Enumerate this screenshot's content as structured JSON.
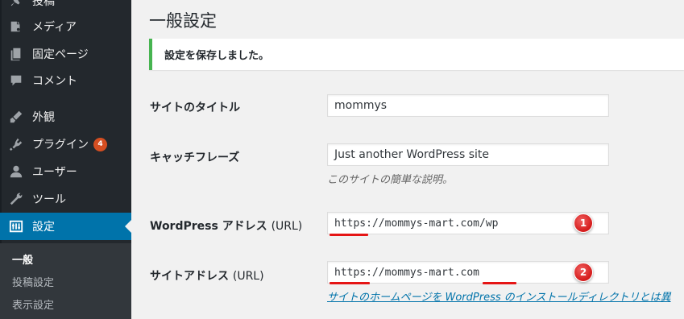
{
  "sidebar": {
    "items": [
      {
        "label": "投稿",
        "icon": "pin-icon"
      },
      {
        "label": "メディア",
        "icon": "media-icon"
      },
      {
        "label": "固定ページ",
        "icon": "page-icon"
      },
      {
        "label": "コメント",
        "icon": "comment-icon"
      },
      {
        "label": "外観",
        "icon": "brush-icon"
      },
      {
        "label": "プラグイン",
        "icon": "plugin-icon",
        "badge": "4"
      },
      {
        "label": "ユーザー",
        "icon": "user-icon"
      },
      {
        "label": "ツール",
        "icon": "wrench-icon"
      },
      {
        "label": "設定",
        "icon": "settings-icon",
        "active": true
      }
    ],
    "submenu": [
      {
        "label": "一般",
        "current": true
      },
      {
        "label": "投稿設定"
      },
      {
        "label": "表示設定"
      }
    ]
  },
  "main": {
    "title": "一般設定",
    "notice": "設定を保存しました。",
    "fields": {
      "site_title": {
        "label": "サイトのタイトル",
        "value": "mommys"
      },
      "tagline": {
        "label": "キャッチフレーズ",
        "value": "Just another WordPress site",
        "description": "このサイトの簡単な説明。"
      },
      "wp_address": {
        "label_main": "WordPress アドレス",
        "label_suffix": "(URL)",
        "value": "https://mommys-mart.com/wp"
      },
      "site_address": {
        "label_main": "サイトアドレス",
        "label_suffix": "(URL)",
        "value": "https://mommys-mart.com",
        "link": "サイトのホームページを WordPress のインストールディレクトリとは異"
      }
    },
    "annotations": {
      "badge1": "1",
      "badge2": "2",
      "color": "#e51515"
    }
  },
  "colors": {
    "sidebar_bg": "#23282d",
    "active_bg": "#0073aa",
    "notice_border": "#46b450",
    "link": "#0073aa"
  }
}
